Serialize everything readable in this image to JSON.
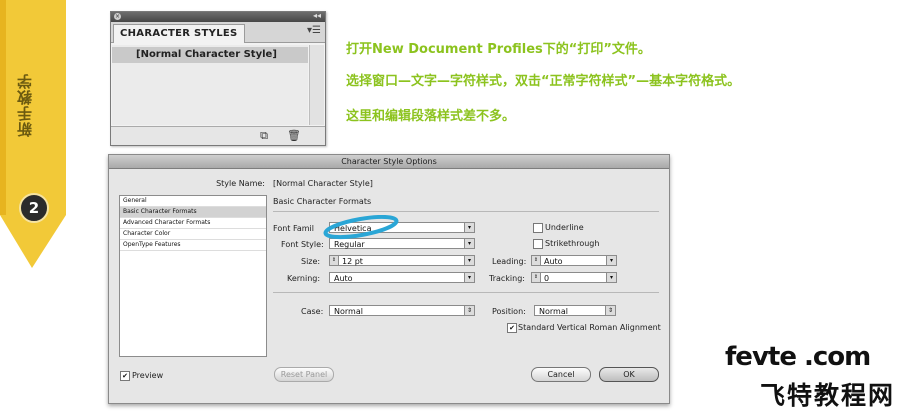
{
  "banner": {
    "text": "新手教学",
    "step": "2",
    "color": "#f2c938"
  },
  "panel": {
    "tab": "CHARACTER STYLES",
    "menu_icon": "menu-icon",
    "items": [
      "[Normal Character Style]"
    ]
  },
  "instructions": [
    "打开New Document Profiles下的“打印”文件。",
    "选择窗口—文字—字符样式，双击“正常字符样式”—基本字符格式。",
    "这里和编辑段落样式差不多。"
  ],
  "dialog": {
    "title": "Character Style Options",
    "style_name_label": "Style Name:",
    "style_name_value": "[Normal Character Style]",
    "categories": [
      "General",
      "Basic Character Formats",
      "Advanced Character Formats",
      "Character Color",
      "OpenType Features"
    ],
    "selected_category": "Basic Character Formats",
    "section_title": "Basic Character Formats",
    "font_family_label": "Font Famil",
    "font_family_value": "Helvetica",
    "font_style_label": "Font Style:",
    "font_style_value": "Regular",
    "size_label": "Size:",
    "size_value": "12 pt",
    "kerning_label": "Kerning:",
    "kerning_value": "Auto",
    "underline_label": "Underline",
    "strikethrough_label": "Strikethrough",
    "leading_label": "Leading:",
    "leading_value": "Auto",
    "tracking_label": "Tracking:",
    "tracking_value": "0",
    "case_label": "Case:",
    "case_value": "Normal",
    "position_label": "Position:",
    "position_value": "Normal",
    "standard_vertical_label": "Standard Vertical Roman Alignment",
    "preview_label": "Preview",
    "reset_label": "Reset Panel",
    "cancel_label": "Cancel",
    "ok_label": "OK",
    "highlight_color": "#2aa6d6"
  },
  "watermark": {
    "line1": "fevte .com",
    "line2": "飞特教程网"
  }
}
